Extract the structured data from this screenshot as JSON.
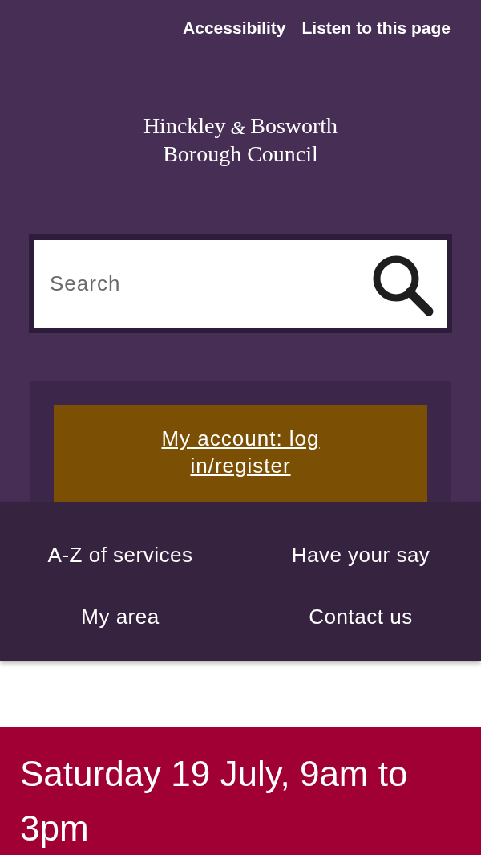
{
  "top_links": [
    "Accessibility",
    "Listen to this page"
  ],
  "logo": {
    "line_1_start": "Hinckley",
    "ampersand": "&",
    "line_1_end": "Bosworth",
    "line_2": "Borough Council"
  },
  "search": {
    "placeholder": "Search"
  },
  "account_button": "My account: log in/register",
  "nav": [
    "A-Z of services",
    "Have your say",
    "My area",
    "Contact us"
  ],
  "banner": {
    "title": "Saturday 19 July, 9am to 3pm"
  }
}
